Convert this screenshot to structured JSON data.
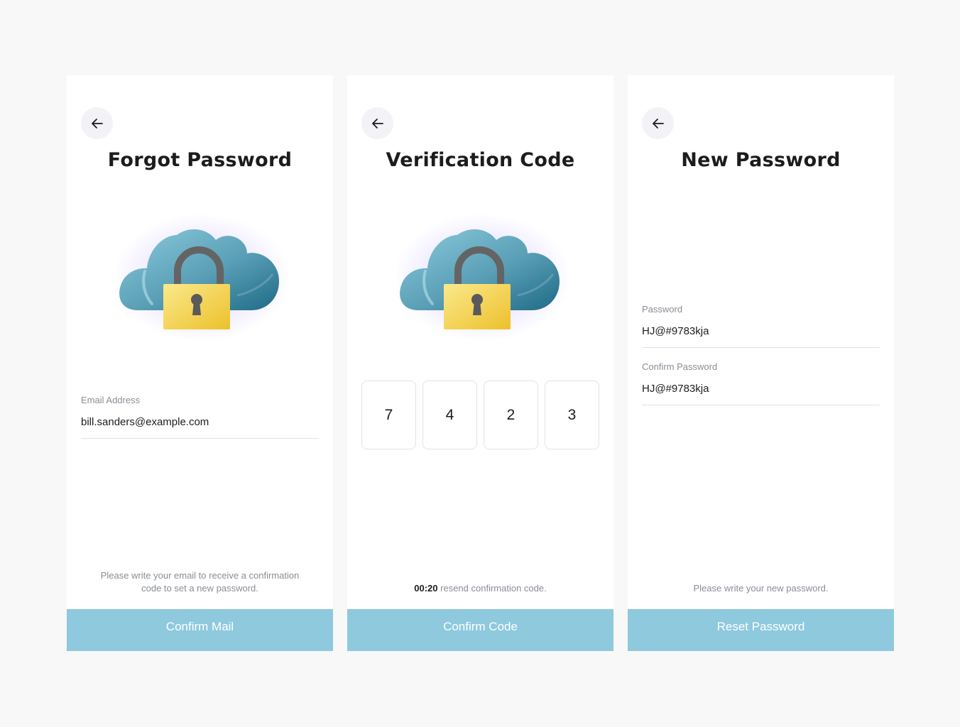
{
  "screens": [
    {
      "title": "Forgot Password",
      "email": {
        "label": "Email Address",
        "value": "bill.sanders@example.com"
      },
      "hint": "Please write your email to receive a confirmation code to set a new password.",
      "button": "Confirm Mail"
    },
    {
      "title": "Verification Code",
      "code": [
        "7",
        "4",
        "2",
        "3"
      ],
      "timer": "00:20",
      "resend": "resend confirmation code.",
      "button": "Confirm Code"
    },
    {
      "title": "New Password",
      "password": {
        "label": "Password",
        "value": "HJ@#9783kja"
      },
      "confirm": {
        "label": "Confirm Password",
        "value": "HJ@#9783kja"
      },
      "hint": "Please write your new password.",
      "button": "Reset Password"
    }
  ],
  "icons": {
    "back": "arrow-left-icon",
    "illustration": "cloud-lock-icon"
  },
  "colors": {
    "background": "#f8f8f8",
    "card": "#ffffff",
    "button": "#8ec9dd",
    "button_text": "#ffffff",
    "title": "#1c1c1c",
    "muted": "#8a8d96",
    "back_button_bg": "#f3f3f7",
    "cloud_light": "#7fc0d5",
    "cloud_dark": "#226f8b",
    "lock_body": "#f2d24a",
    "lock_shackle": "#6b6b6b"
  }
}
